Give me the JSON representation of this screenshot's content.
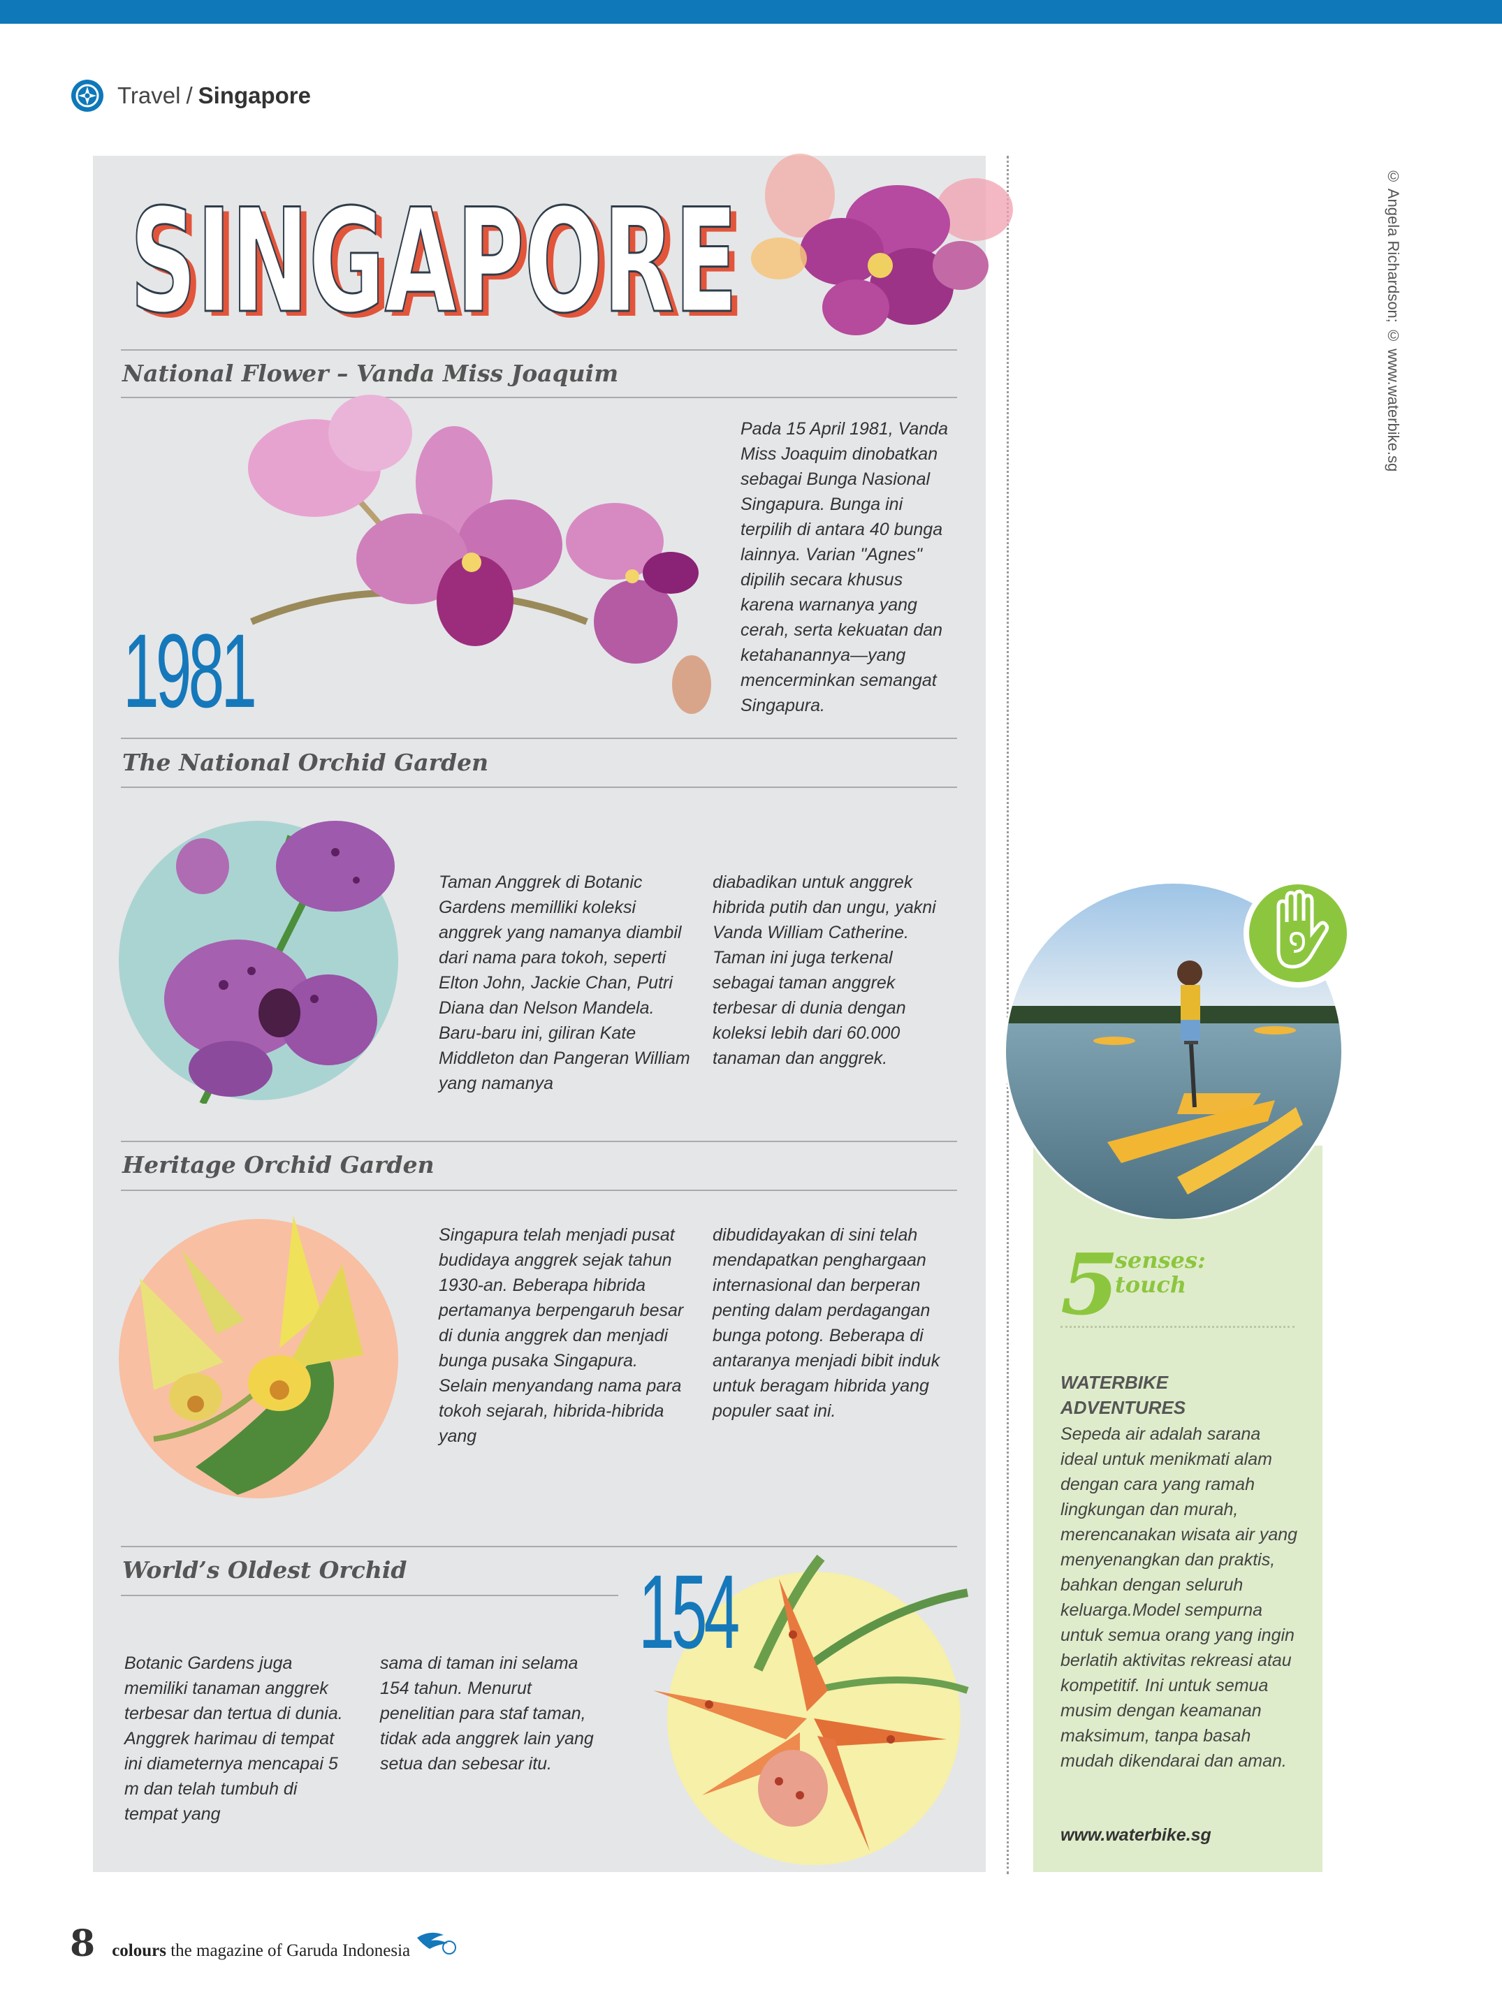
{
  "header": {
    "section": "Travel",
    "separator": "/",
    "subsection": "Singapore"
  },
  "credit": "© Angela Richardson; © www.waterbike.sg",
  "page_title": "SINGAPORE",
  "sections": [
    {
      "title": "National Flower – Vanda Miss Joaquim",
      "number": "1981",
      "body": "Pada 15 April 1981, Vanda Miss Joaquim dinobatkan sebagai Bunga Nasional Singapura. Bunga ini terpilih di antara 40 bunga lainnya. Varian \"Agnes\" dipilih secara khusus karena warnanya yang cerah, serta kekuatan dan ketahanannya—yang mencerminkan semangat Singapura."
    },
    {
      "title": "The National Orchid Garden",
      "col1": "Taman Anggrek di Botanic Gardens memilliki koleksi anggrek yang namanya diambil dari nama para tokoh, seperti Elton John, Jackie Chan, Putri Diana dan Nelson Mandela. Baru-baru ini, giliran Kate Middleton dan Pangeran William yang namanya",
      "col2": "diabadikan untuk anggrek hibrida putih dan ungu, yakni Vanda William Catherine. Taman ini juga terkenal sebagai taman anggrek terbesar di dunia dengan koleksi lebih dari 60.000 tanaman dan anggrek."
    },
    {
      "title": "Heritage Orchid Garden",
      "col1": "Singapura telah menjadi pusat budidaya anggrek sejak tahun 1930-an. Beberapa hibrida pertamanya berpengaruh besar di dunia anggrek dan menjadi bunga pusaka Singapura. Selain menyandang nama para tokoh sejarah, hibrida-hibrida yang",
      "col2": "dibudidayakan di sini telah mendapatkan penghargaan internasional dan berperan penting dalam perdagangan bunga potong. Beberapa di antaranya menjadi bibit induk untuk beragam hibrida yang populer saat ini."
    },
    {
      "title": "World’s Oldest Orchid",
      "number": "154",
      "col1": "Botanic Gardens juga memiliki tanaman anggrek terbesar dan tertua di dunia. Anggrek harimau di tempat ini diameternya mencapai 5 m dan telah tumbuh di tempat yang",
      "col2": "sama di taman ini selama 154 tahun. Menurut penelitian para staf taman, tidak ada anggrek lain yang setua dan sebesar itu."
    }
  ],
  "sidebar": {
    "senses_number": "5",
    "senses_line1": "senses:",
    "senses_line2": "touch",
    "heading_line1": "WATERBIKE",
    "heading_line2": "ADVENTURES",
    "body": "Sepeda air adalah sarana ideal untuk menikmati alam dengan cara yang ramah lingkungan dan murah, merencanakan wisata air yang menyenangkan dan praktis, bahkan dengan seluruh keluarga.Model sempurna untuk semua orang yang ingin berlatih aktivitas rekreasi atau kompetitif. Ini untuk semua musim dengan keamanan maksimum, tanpa basah mudah dikendarai dan aman.",
    "url": "www.waterbike.sg"
  },
  "footer": {
    "page_number": "8",
    "mag_brand": "colours",
    "mag_text": "the magazine of",
    "mag_airline": "Garuda Indonesia"
  },
  "colors": {
    "accent_blue": "#1578ba",
    "title_red": "#e2553b",
    "senses_green": "#8cc63f",
    "panel_gray": "#e5e6e8",
    "sidebar_green": "#dfeccb"
  }
}
